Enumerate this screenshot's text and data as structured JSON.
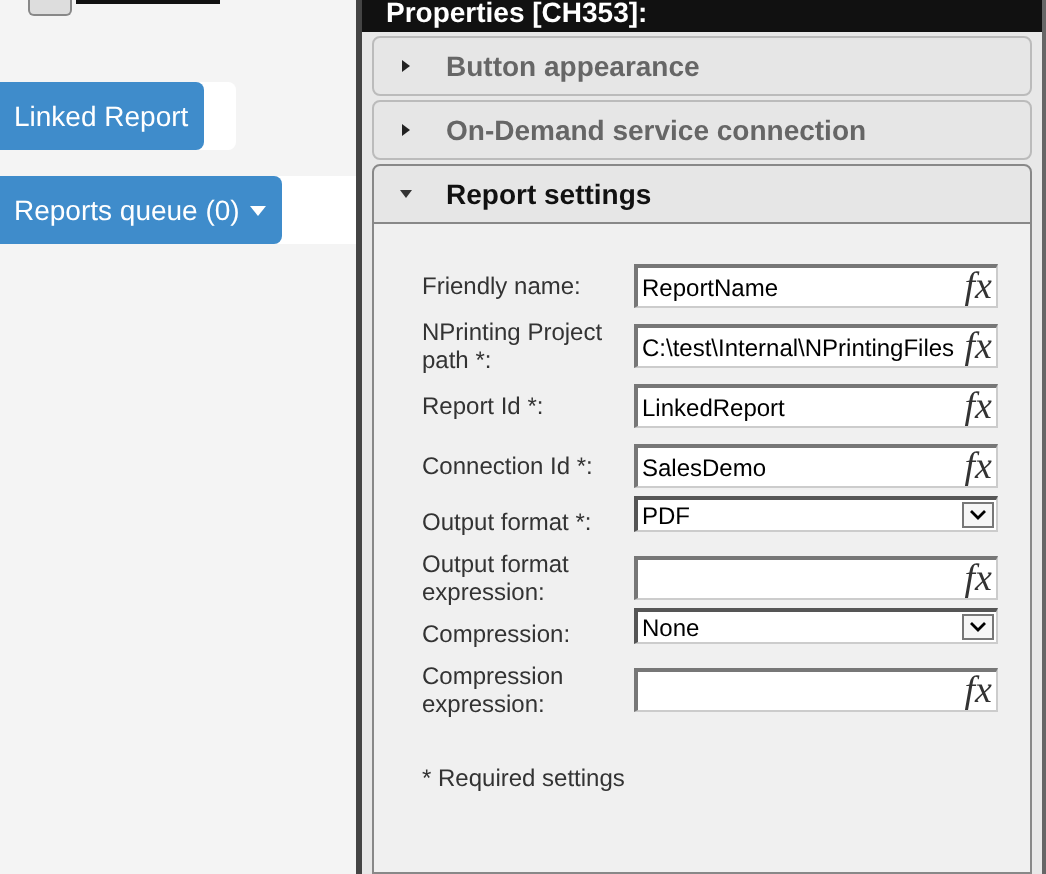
{
  "buttons": [
    {
      "label": "Linked Report",
      "kind": "plain"
    },
    {
      "label": "Reports queue (0)",
      "kind": "dropdown"
    }
  ],
  "panel": {
    "title": "Properties [CH353]:",
    "sections": [
      {
        "title": "Button appearance",
        "expanded": false
      },
      {
        "title": "On-Demand service connection",
        "expanded": false
      },
      {
        "title": "Report settings",
        "expanded": true
      }
    ],
    "fields": [
      {
        "label": "Friendly name:",
        "kind": "text",
        "value": "ReportName",
        "fx": "fx"
      },
      {
        "label": "NPrinting Project path *:",
        "kind": "text",
        "value": "C:\\test\\Internal\\NPrintingFiles",
        "fx": "fx"
      },
      {
        "label": "Report Id *:",
        "kind": "text",
        "value": "LinkedReport",
        "fx": "fx"
      },
      {
        "label": "Connection Id *:",
        "kind": "text",
        "value": "SalesDemo",
        "fx": "fx"
      },
      {
        "label": "Output format *:",
        "kind": "select",
        "value": "PDF"
      },
      {
        "label": "Output format expression:",
        "kind": "text",
        "fx": "fx"
      },
      {
        "label": "Compression:",
        "kind": "select",
        "value": "None"
      },
      {
        "label": "Compression expression:",
        "kind": "text",
        "fx": "fx"
      }
    ],
    "note": "* Required settings"
  }
}
